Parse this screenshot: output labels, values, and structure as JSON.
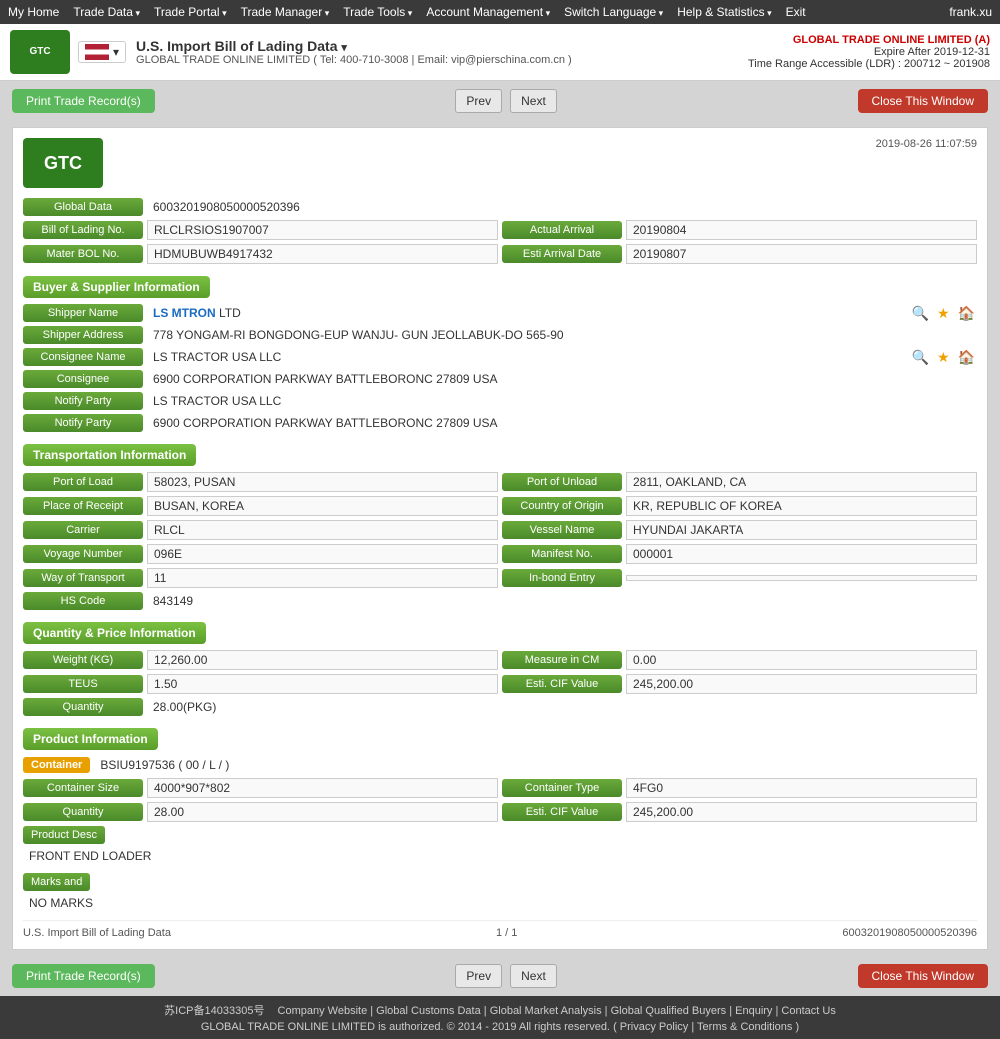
{
  "topNav": {
    "items": [
      "My Home",
      "Trade Data",
      "Trade Portal",
      "Trade Manager",
      "Trade Tools",
      "Account Management",
      "Switch Language",
      "Help & Statistics",
      "Exit"
    ],
    "user": "frank.xu"
  },
  "header": {
    "title": "U.S. Import Bill of Lading Data",
    "subtitle": "GLOBAL TRADE ONLINE LIMITED ( Tel: 400-710-3008 | Email: vip@pierschina.com.cn )",
    "accountName": "GLOBAL TRADE ONLINE LIMITED (A)",
    "expireLabel": "Expire After 2019-12-31",
    "timeRange": "Time Range Accessible (LDR) : 200712 ~ 201908"
  },
  "actionBar": {
    "printBtn": "Print Trade Record(s)",
    "prevBtn": "Prev",
    "nextBtn": "Next",
    "closeBtn": "Close This Window"
  },
  "record": {
    "timestamp": "2019-08-26 11:07:59",
    "globalData": {
      "label": "Global Data",
      "value": "6003201908050000520396"
    },
    "billOfLading": {
      "label": "Bill of Lading No.",
      "value": "RLCLRSIOS1907007",
      "actualArrivalLabel": "Actual Arrival",
      "actualArrivalValue": "20190804"
    },
    "materBOL": {
      "label": "Mater BOL No.",
      "value": "HDMUBUWB4917432",
      "estiArrivalLabel": "Esti Arrival Date",
      "estiArrivalValue": "20190807"
    },
    "buyerSupplier": {
      "sectionTitle": "Buyer & Supplier Information",
      "shipperNameLabel": "Shipper Name",
      "shipperNameValue": "LS MTRON LTD",
      "shipperNameHighlight": "LS MTRON",
      "shipperNameRest": " LTD",
      "shipperAddressLabel": "Shipper Address",
      "shipperAddressValue": "778 YONGAM-RI BONGDONG-EUP WANJU- GUN JEOLLABUK-DO 565-90",
      "consigneeNameLabel": "Consignee Name",
      "consigneeNameValue": "LS TRACTOR USA LLC",
      "consigneeLabel": "Consignee",
      "consigneeValue": "6900 CORPORATION PARKWAY BATTLEBORONC 27809 USA",
      "notifyPartyLabel": "Notify Party",
      "notifyParty1Value": "LS TRACTOR USA LLC",
      "notifyParty2Value": "6900 CORPORATION PARKWAY BATTLEBORONC 27809 USA"
    },
    "transportation": {
      "sectionTitle": "Transportation Information",
      "portOfLoadLabel": "Port of Load",
      "portOfLoadValue": "58023, PUSAN",
      "portOfUnloadLabel": "Port of Unload",
      "portOfUnloadValue": "2811, OAKLAND, CA",
      "placeOfReceiptLabel": "Place of Receipt",
      "placeOfReceiptValue": "BUSAN, KOREA",
      "countryOfOriginLabel": "Country of Origin",
      "countryOfOriginValue": "KR, REPUBLIC OF KOREA",
      "carrierLabel": "Carrier",
      "carrierValue": "RLCL",
      "vesselNameLabel": "Vessel Name",
      "vesselNameValue": "HYUNDAI JAKARTA",
      "voyageNumberLabel": "Voyage Number",
      "voyageNumberValue": "096E",
      "manifestNoLabel": "Manifest No.",
      "manifestNoValue": "000001",
      "wayOfTransportLabel": "Way of Transport",
      "wayOfTransportValue": "11",
      "inBondEntryLabel": "In-bond Entry",
      "inBondEntryValue": "",
      "hsCodeLabel": "HS Code",
      "hsCodeValue": "843149"
    },
    "quantityPrice": {
      "sectionTitle": "Quantity & Price Information",
      "weightLabel": "Weight (KG)",
      "weightValue": "12,260.00",
      "measureInCMLabel": "Measure in CM",
      "measureInCMValue": "0.00",
      "teusLabel": "TEUS",
      "teusValue": "1.50",
      "estiCIFValueLabel": "Esti. CIF Value",
      "estiCIFValue1": "245,200.00",
      "quantityLabel": "Quantity",
      "quantityValue": "28.00(PKG)"
    },
    "product": {
      "sectionTitle": "Product Information",
      "containerLabel": "Container",
      "containerValue": "BSIU9197536 ( 00 / L / )",
      "containerSizeLabel": "Container Size",
      "containerSizeValue": "4000*907*802",
      "containerTypeLabel": "Container Type",
      "containerTypeValue": "4FG0",
      "quantityLabel": "Quantity",
      "quantityValue": "28.00",
      "estiCIFLabel": "Esti. CIF Value",
      "estiCIFValue": "245,200.00",
      "productDescLabel": "Product Desc",
      "productDescValue": "FRONT END LOADER",
      "marksLabel": "Marks and",
      "marksValue": "NO MARKS"
    },
    "footer": {
      "leftText": "U.S. Import Bill of Lading Data",
      "pageInfo": "1 / 1",
      "rightText": "6003201908050000520396"
    }
  },
  "bottomFooter": {
    "icp": "苏ICP备14033305号",
    "links": [
      "Company Website",
      "Global Customs Data",
      "Global Market Analysis",
      "Global Qualified Buyers",
      "Enquiry",
      "Contact Us"
    ],
    "copyright": "GLOBAL TRADE ONLINE LIMITED is authorized. © 2014 - 2019 All rights reserved.",
    "privacyLabel": "Privacy Policy",
    "termsLabel": "Terms & Conditions"
  }
}
